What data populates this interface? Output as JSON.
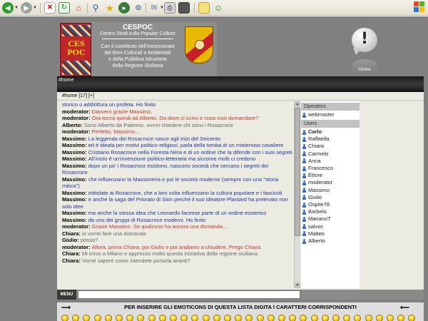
{
  "browser": {
    "toolbar_icons": [
      "back-icon",
      "forward-icon",
      "stop-icon",
      "refresh-icon",
      "home-icon",
      "search-icon",
      "favorites-icon",
      "media-icon",
      "mail-icon",
      "print-icon",
      "edit-icon",
      "discuss-icon",
      "messenger-icon"
    ]
  },
  "header": {
    "logo_text_top": "CES",
    "logo_text_bottom": "POC",
    "title": "CESPOC",
    "subtitle_prefix": "Centro Studi sulla ",
    "subtitle_italic": "Popular Culture",
    "body_lines": [
      "Con il contributo dell'Assessorato",
      "dei Beni Culturali e Ambientali",
      "e della Pubblica Istruzione",
      "della Regione Siciliana"
    ],
    "online_label": "Online"
  },
  "channel": {
    "tab_label": "#home",
    "header": "#home [17] [+]"
  },
  "messages": [
    {
      "nick": "",
      "text": "storico o addirittura un profeta. Ho finito",
      "color": "blue"
    },
    {
      "nick": "moderator:",
      "text": "Davvero grazie Massimo.",
      "color": "red"
    },
    {
      "nick": "moderator:",
      "text": "Ora tocca quindi ad Alberto. Da dove ci scrivi e cosa vuoi domandare?",
      "color": "red"
    },
    {
      "nick": "Alberto:",
      "text": "Sono Alberto da Palermo. vorrei chiedere chi sono i Rosacroce",
      "color": "grey"
    },
    {
      "nick": "moderator:",
      "text": "Perfetto, Massimo...",
      "color": "red"
    },
    {
      "nick": "Massimo:",
      "text": "La leggenda dei Rosacroce nasce agli inizi del Seicento",
      "color": "blue"
    },
    {
      "nick": "Massimo:",
      "text": "ed è ideata per motivi politico-religiosi. parla della tomba di un misterioso cavaliere",
      "color": "blue"
    },
    {
      "nick": "Massimo:",
      "text": "Cristiano Rosacroce nella Foresta Nera e di un ordine che la difende con i suoi segreti",
      "color": "blue"
    },
    {
      "nick": "Massimo:",
      "text": "All'inizio è un'invenzione politico-letteraria ma siccome molti ci credono",
      "color": "blue"
    },
    {
      "nick": "Massimo:",
      "text": "dopo un po' i Rosacroce esistono, nascono società che cercano i segreti dei Rosacroce",
      "color": "blue"
    },
    {
      "nick": "Massimo:",
      "text": "che influenzano la Massoneria e poi le società moderne (sempre con una \"storia mitica\")",
      "color": "blue"
    },
    {
      "nick": "Massimo:",
      "text": "intitolate ai Rosacroce, che a loro volta influenzano la cultura popolare e i fascicoli",
      "color": "blue"
    },
    {
      "nick": "Massimo:",
      "text": "e anche la saga del Priorato di Sion perché il suo ideatore Plantard ha prelevato non solo idee",
      "color": "blue"
    },
    {
      "nick": "Massimo:",
      "text": "ma anche la stessa idea che Leonardo facesse parte di un ordine esoterico",
      "color": "blue"
    },
    {
      "nick": "Massimo:",
      "text": "da uno dei gruppi di Rosacroce moderni. Ho finito",
      "color": "blue"
    },
    {
      "nick": "moderator:",
      "text": "Grazie Massimo. Se qualcuno ha ancora una domanda...",
      "color": "red"
    },
    {
      "nick": "Chiara:",
      "text": "io vorrei fare una domanda",
      "color": "grey"
    },
    {
      "nick": "Giulio:",
      "text": "posso?",
      "color": "grey"
    },
    {
      "nick": "moderator:",
      "text": "Allora, prima Chiara, poi Giulio e poi andiamo a chiudere, Prego Chiara.",
      "color": "red"
    },
    {
      "nick": "Chiara:",
      "text": "Mi trovo a Milano e apprezzo molto questa iniziativa della regione siciliana",
      "color": "grey"
    },
    {
      "nick": "Chiara:",
      "text": "Vorrei sapere come intendete portarla avanti?",
      "color": "grey"
    }
  ],
  "userlist": {
    "operators_label": "Operators",
    "operators": [
      "webmaster"
    ],
    "users_label": "Users",
    "users": [
      "Carlo",
      "Raffaella",
      "Chiara",
      "Carmelo",
      "Anna",
      "Francesco",
      "Ettore",
      "moderator",
      "Massimo",
      "Giulio",
      "Ospite78",
      "Barbelo",
      "MarianoT",
      "salvoc",
      "Matteo",
      "Alberto"
    ]
  },
  "input": {
    "menu_label": "MENU",
    "value": ""
  },
  "emoticons": {
    "info": "PER INSERIRE GLI EMOTICONS DI QUESTA LISTA DIGITA I CARATTERI CORRISPONDENTI",
    "count": 33
  },
  "colors": {
    "blue_text": "#2233aa",
    "red_text": "#cc3333",
    "grey_text": "#666666",
    "page_bg": "#808080",
    "panel_bg": "#ecebe1"
  }
}
